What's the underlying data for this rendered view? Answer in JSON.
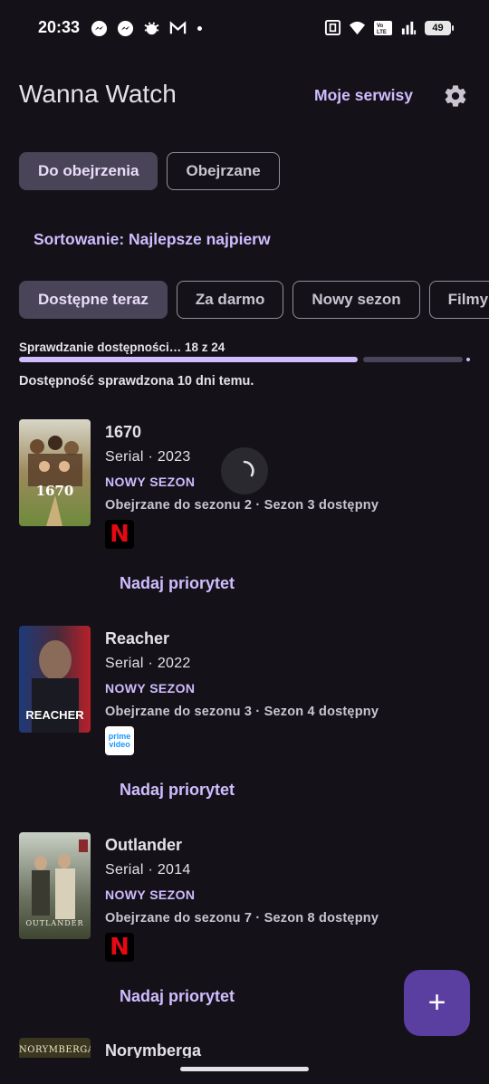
{
  "status_bar": {
    "time": "20:33",
    "left_icons": [
      "messenger-icon",
      "messenger-icon",
      "bug-icon",
      "gmail-icon",
      "dot-icon"
    ],
    "right_icons": [
      "nfc-icon",
      "wifi-icon",
      "volte-icon",
      "signal-icon"
    ],
    "battery": "49"
  },
  "header": {
    "title": "Wanna Watch",
    "services_link": "Moje serwisy",
    "settings_icon": "gear-icon"
  },
  "tabs": [
    {
      "label": "Do obejrzenia",
      "active": true
    },
    {
      "label": "Obejrzane",
      "active": false
    }
  ],
  "sort_label": "Sortowanie: Najlepsze najpierw",
  "filters": [
    {
      "label": "Dostępne teraz",
      "active": true
    },
    {
      "label": "Za darmo",
      "active": false
    },
    {
      "label": "Nowy sezon",
      "active": false
    },
    {
      "label": "Filmy",
      "active": false
    }
  ],
  "availability": {
    "progress_text": "Sprawdzanie dostępności… 18 z 24",
    "checked": 18,
    "total": 24,
    "checked_text": "Dostępność sprawdzona 10 dni temu."
  },
  "items": [
    {
      "title": "1670",
      "meta": "Serial · 2023",
      "badge": "NOWY SEZON",
      "progress": "Obejrzane do sezonu 2 · Sezon 3 dostępny",
      "service": "Netflix",
      "service_icon": "netflix-logo-icon",
      "poster_text": "1670",
      "action": "Nadaj priorytet"
    },
    {
      "title": "Reacher",
      "meta": "Serial · 2022",
      "badge": "NOWY SEZON",
      "progress": "Obejrzane do sezonu 3 · Sezon 4 dostępny",
      "service": "Prime Video",
      "service_icon": "prime-video-logo-icon",
      "service_text_1": "prime",
      "service_text_2": "video",
      "poster_text": "REACHER",
      "action": "Nadaj priorytet"
    },
    {
      "title": "Outlander",
      "meta": "Serial · 2014",
      "badge": "NOWY SEZON",
      "progress": "Obejrzane do sezonu 7 · Sezon 8 dostępny",
      "service": "Netflix",
      "service_icon": "netflix-logo-icon",
      "poster_text": "OUTLANDER",
      "action": "Nadaj priorytet"
    },
    {
      "title": "Norymberga",
      "poster_text": "NORYMBERGA"
    }
  ],
  "netflix_letter": "N",
  "fab_icon": "plus-icon",
  "fab_label": "+"
}
